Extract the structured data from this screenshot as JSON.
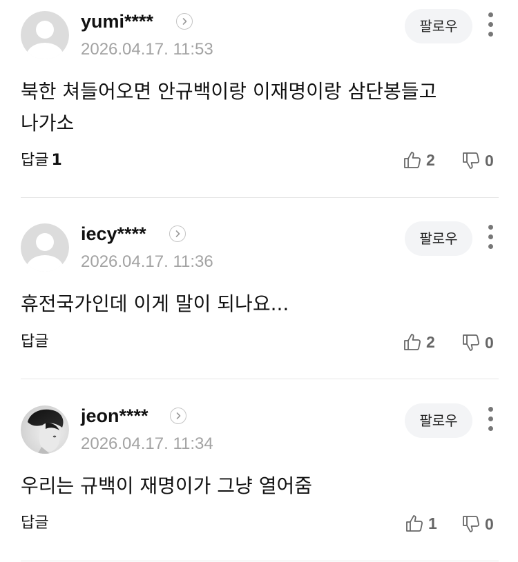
{
  "comments": [
    {
      "username": "yumi****",
      "timestamp": "2026.04.17. 11:53",
      "follow_label": "팔로우",
      "avatar": "default-avatar-icon",
      "text": "북한 쳐들어오면 안규백이랑 이재명이랑 삼단봉들고 나가소",
      "reply_label": "답글",
      "reply_count": "1",
      "likes": "2",
      "dislikes": "0"
    },
    {
      "username": "iecy****",
      "timestamp": "2026.04.17. 11:36",
      "follow_label": "팔로우",
      "avatar": "default-avatar-icon",
      "text": "휴전국가인데 이게 말이 되나요...",
      "reply_label": "답글",
      "reply_count": "",
      "likes": "2",
      "dislikes": "0"
    },
    {
      "username": "jeon****",
      "timestamp": "2026.04.17. 11:34",
      "follow_label": "팔로우",
      "avatar": "photo-avatar",
      "text": "우리는 규백이 재명이가 그냥 열어줌",
      "reply_label": "답글",
      "reply_count": "",
      "likes": "1",
      "dislikes": "0"
    }
  ],
  "colors": {
    "divider": "#e6e6e6",
    "follow_bg": "#f3f4f6",
    "timestamp": "#a3a3a3",
    "vote": "#666666"
  }
}
